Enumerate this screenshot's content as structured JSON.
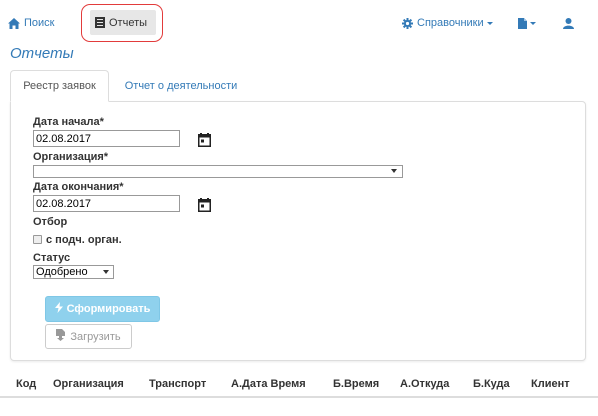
{
  "navbar": {
    "search_label": "Поиск",
    "reports_label": "Отчеты",
    "directories_label": "Справочники"
  },
  "page": {
    "title": "Отчеты"
  },
  "tabs": [
    {
      "label": "Реестр заявок",
      "active": true
    },
    {
      "label": "Отчет о деятельности",
      "active": false
    }
  ],
  "form": {
    "start_date_label": "Дата начала*",
    "start_date_value": "02.08.2017",
    "organization_label": "Организация*",
    "organization_value": "",
    "end_date_label": "Дата окончания*",
    "end_date_value": "02.08.2017",
    "filter_label": "Отбор",
    "checkbox_label": "с подч. орган.",
    "checkbox_checked": false,
    "status_label": "Статус",
    "status_value": "Одобрено",
    "generate_button": "Сформировать",
    "load_button": "Загрузить"
  },
  "table": {
    "columns": [
      "Код",
      "Организация",
      "Транспорт",
      "А.Дата Время",
      "Б.Время",
      "А.Откуда",
      "Б.Куда",
      "Клиент"
    ]
  },
  "colors": {
    "link": "#337ab7",
    "highlight_border": "#e23b3b",
    "primary_button": "#8fd1ed"
  },
  "icons": {
    "home": "home-icon",
    "reports": "list-icon",
    "directories": "gear-icon",
    "document": "file-icon",
    "user": "user-icon",
    "calendar": "calendar-icon",
    "generate": "lightning-icon",
    "load": "file-download-icon"
  }
}
